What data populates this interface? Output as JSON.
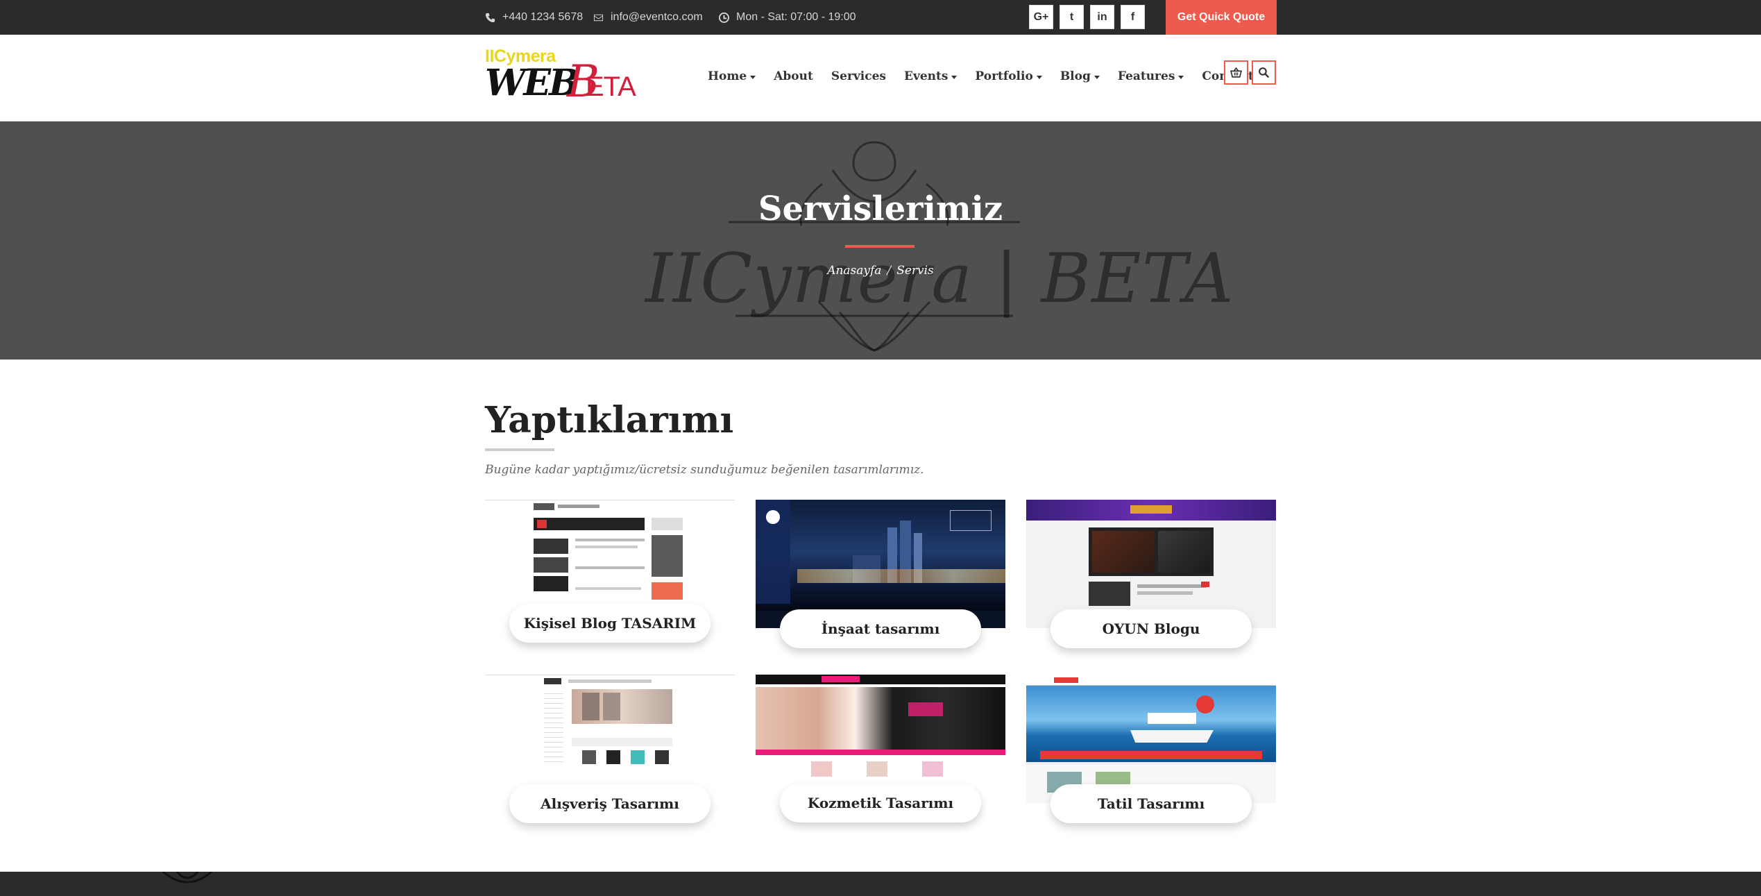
{
  "topbar": {
    "phone": "+440 1234 5678",
    "email": "info@eventco.com",
    "hours": "Mon - Sat: 07:00 - 19:00",
    "socials": [
      "G+",
      "t",
      "in",
      "f"
    ],
    "quote_label": "Get Quick Quote"
  },
  "logo": {
    "top": "IICymera",
    "web": "WEB",
    "beta": "ETA",
    "b": "B"
  },
  "nav": {
    "items": [
      {
        "label": "Home",
        "dropdown": true
      },
      {
        "label": "About",
        "dropdown": false
      },
      {
        "label": "Services",
        "dropdown": false
      },
      {
        "label": "Events",
        "dropdown": true
      },
      {
        "label": "Portfolio",
        "dropdown": true
      },
      {
        "label": "Blog",
        "dropdown": true
      },
      {
        "label": "Features",
        "dropdown": true
      },
      {
        "label": "Contact",
        "dropdown": true
      }
    ]
  },
  "hero": {
    "title": "Servislerimiz",
    "watermark": "IICymera | BETA",
    "breadcrumb": {
      "home": "Anasayfa",
      "separator": "/",
      "current": "Servis"
    }
  },
  "main": {
    "title": "Yaptıklarımı",
    "subtitle": "Bugüne kadar yaptığımız/ücretsiz sunduğumuz beğenilen tasarımlarımız.",
    "cards": [
      {
        "label": "Kişisel Blog TASARIM"
      },
      {
        "label": "İnşaat tasarımı"
      },
      {
        "label": "OYUN Blogu"
      },
      {
        "label": "Alışveriş Tasarımı"
      },
      {
        "label": "Kozmetik Tasarımı"
      },
      {
        "label": "Tatil Tasarımı"
      }
    ]
  },
  "colors": {
    "accent": "#ee5b4e",
    "dark": "#2b2b2b",
    "hero_bg": "#505050"
  }
}
